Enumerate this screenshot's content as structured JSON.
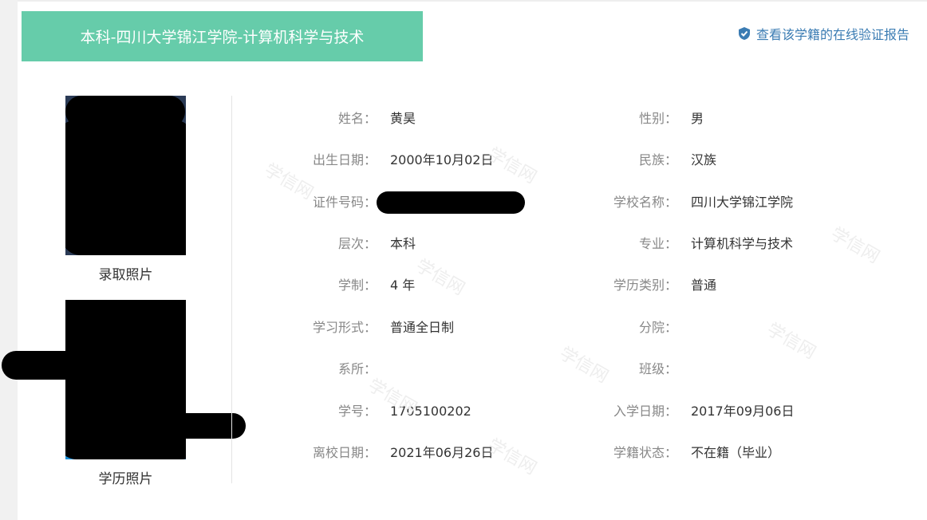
{
  "banner": {
    "title": "本科-四川大学锦江学院-计算机科学与技术"
  },
  "verify_link": {
    "label": "查看该学籍的在线验证报告",
    "icon": "shield-check-icon"
  },
  "photos": {
    "admission_caption": "录取照片",
    "degree_caption": "学历照片"
  },
  "watermark_text": "学信网",
  "colors": {
    "banner_bg": "#66ccaa",
    "link": "#3b7cb3",
    "label": "#888888",
    "value": "#333333"
  },
  "fields": {
    "name": {
      "label": "姓名：",
      "value": "黄昊"
    },
    "gender": {
      "label": "性别：",
      "value": "男"
    },
    "birthdate": {
      "label": "出生日期：",
      "value": "2000年10月02日"
    },
    "ethnicity": {
      "label": "民族：",
      "value": "汉族"
    },
    "id_number": {
      "label": "证件号码：",
      "value": ""
    },
    "school": {
      "label": "学校名称：",
      "value": "四川大学锦江学院"
    },
    "level": {
      "label": "层次：",
      "value": "本科"
    },
    "major": {
      "label": "专业：",
      "value": "计算机科学与技术"
    },
    "duration": {
      "label": "学制：",
      "value": "4 年"
    },
    "edu_type": {
      "label": "学历类别：",
      "value": "普通"
    },
    "study_form": {
      "label": "学习形式：",
      "value": "普通全日制"
    },
    "branch": {
      "label": "分院：",
      "value": ""
    },
    "department": {
      "label": "系所：",
      "value": ""
    },
    "class": {
      "label": "班级：",
      "value": ""
    },
    "student_no": {
      "label": "学号：",
      "value": "1705100202"
    },
    "enroll_date": {
      "label": "入学日期：",
      "value": "2017年09月06日"
    },
    "leave_date": {
      "label": "离校日期：",
      "value": "2021年06月26日"
    },
    "status": {
      "label": "学籍状态：",
      "value": "不在籍（毕业）"
    }
  }
}
